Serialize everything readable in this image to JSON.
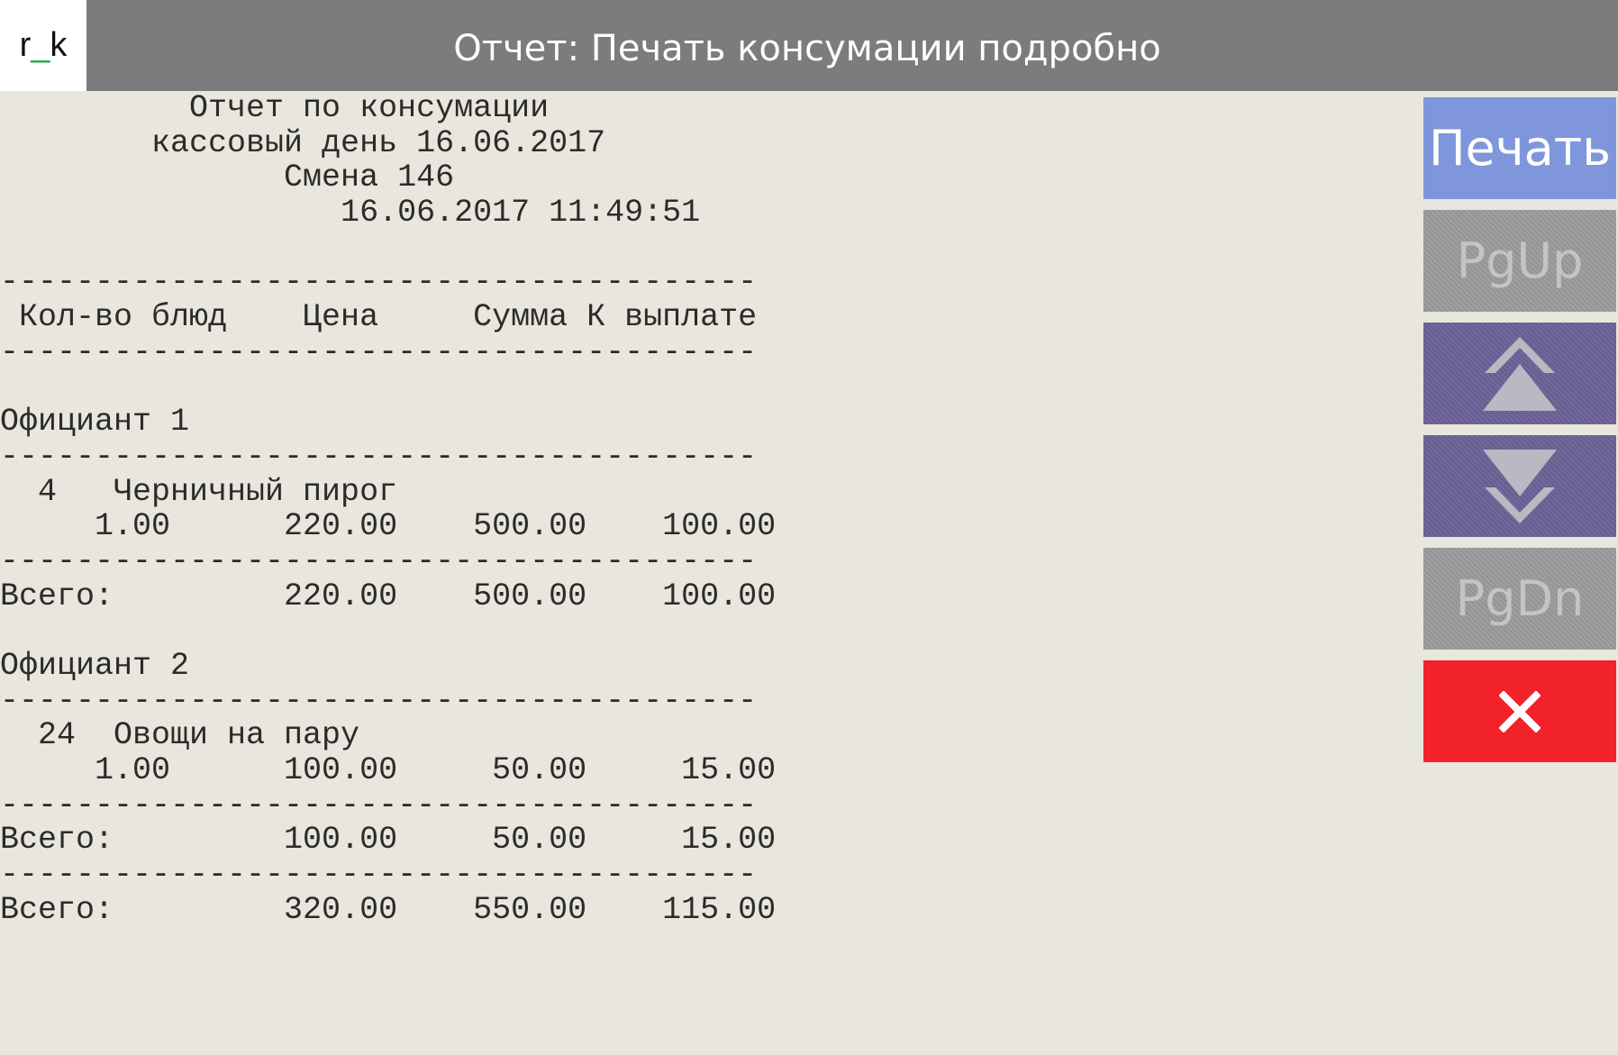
{
  "header": {
    "logo_text_left": "r",
    "logo_text_mid": "_",
    "logo_text_right": "k",
    "title": "Отчет: Печать консумации подробно"
  },
  "report": {
    "lines": [
      "          Отчет по консумации",
      "        кассовый день 16.06.2017",
      "               Смена 146",
      "                  16.06.2017 11:49:51",
      "",
      "----------------------------------------",
      " Кол-во блюд    Цена     Сумма К выплате",
      "----------------------------------------",
      "",
      "Официант 1",
      "----------------------------------------",
      "  4   Черничный пирог",
      "     1.00      220.00    500.00    100.00",
      "----------------------------------------",
      "Всего:         220.00    500.00    100.00",
      "",
      "Официант 2",
      "----------------------------------------",
      "  24  Овощи на пару",
      "     1.00      100.00     50.00     15.00",
      "----------------------------------------",
      "Всего:         100.00     50.00     15.00",
      "----------------------------------------",
      "Всего:         320.00    550.00    115.00"
    ]
  },
  "buttons": {
    "print_label": "Печать",
    "pgup_label": "PgUp",
    "pgdn_label": "PgDn"
  },
  "icons": {
    "scroll_up": "double-chevron-up-icon",
    "scroll_down": "double-chevron-down-icon",
    "close": "close-icon"
  },
  "colors": {
    "header_bg": "#7c7c7c",
    "print_bg": "#7f96dc",
    "nav_bg": "#6b6196",
    "disabled_bg": "#9a9a9a",
    "close_bg": "#f2222a",
    "page_bg": "#e8e6dd"
  }
}
